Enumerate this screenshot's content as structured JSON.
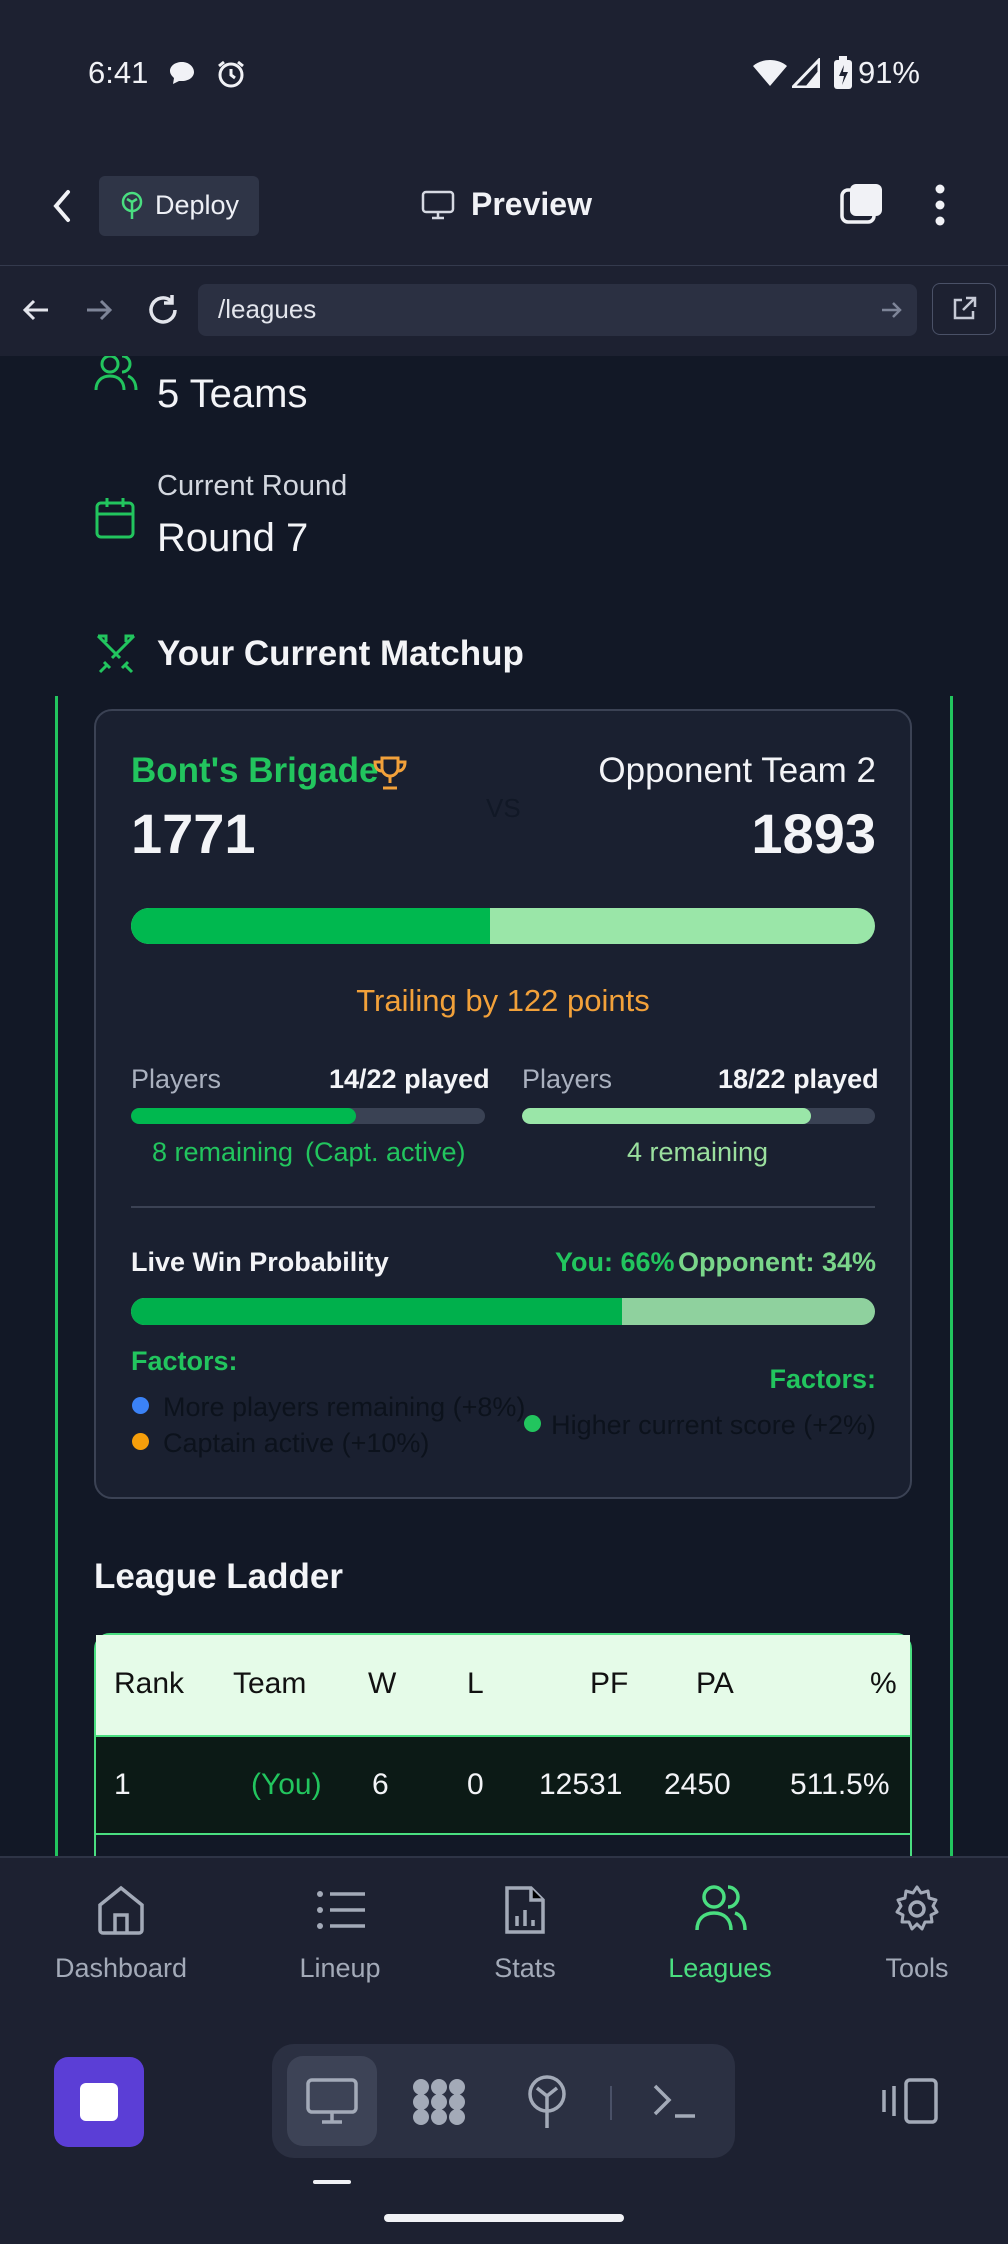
{
  "status_bar": {
    "time": "6:41",
    "battery": "91%"
  },
  "app_bar": {
    "deploy_label": "Deploy",
    "preview_label": "Preview"
  },
  "browser": {
    "url": "/leagues"
  },
  "league_info": {
    "teams_value": "5 Teams",
    "round_label": "Current Round",
    "round_value": "Round 7"
  },
  "matchup": {
    "title": "Your Current Matchup",
    "my_team": "Bont's Brigade",
    "opponent_team": "Opponent Team 2",
    "vs": "VS",
    "my_score": "1771",
    "opponent_score": "1893",
    "score_share_you": 0.483,
    "status": "Trailing by 122 points",
    "my_players_label": "Players",
    "my_players_played": "14/22 played",
    "my_players_fraction": 0.636,
    "my_remaining": "8 remaining",
    "my_captain": "(Capt. active)",
    "opp_players_label": "Players",
    "opp_players_played": "18/22 played",
    "opp_players_fraction": 0.818,
    "opp_remaining": "4 remaining"
  },
  "win_probability": {
    "label": "Live Win Probability",
    "you": "You: 66%",
    "opponent": "Opponent: 34%",
    "you_fraction": 0.66,
    "factors_label_left": "Factors:",
    "factors_left": [
      "More players remaining (+8%)",
      "Captain active (+10%)"
    ],
    "factors_label_right": "Factors:",
    "factors_right": [
      "Higher current score (+2%)"
    ],
    "colors": {
      "blue": "#3b82f6",
      "orange": "#f59e0b",
      "green": "#22c55e"
    }
  },
  "ladder": {
    "title": "League Ladder",
    "headers": [
      "Rank",
      "Team",
      "W",
      "L",
      "PF",
      "PA",
      "%"
    ],
    "rows": [
      {
        "rank": "1",
        "team": "(You)",
        "w": "6",
        "l": "0",
        "pf": "12531",
        "pa": "2450",
        "pct": "511.5%"
      }
    ]
  },
  "bottom_nav": {
    "items": [
      "Dashboard",
      "Lineup",
      "Stats",
      "Leagues",
      "Tools"
    ],
    "active": "Leagues"
  },
  "colors": {
    "accent": "#22c55e",
    "light_accent": "#9ae6a8",
    "warning": "#f2a13a",
    "brand_purple": "#5b3ed6"
  }
}
